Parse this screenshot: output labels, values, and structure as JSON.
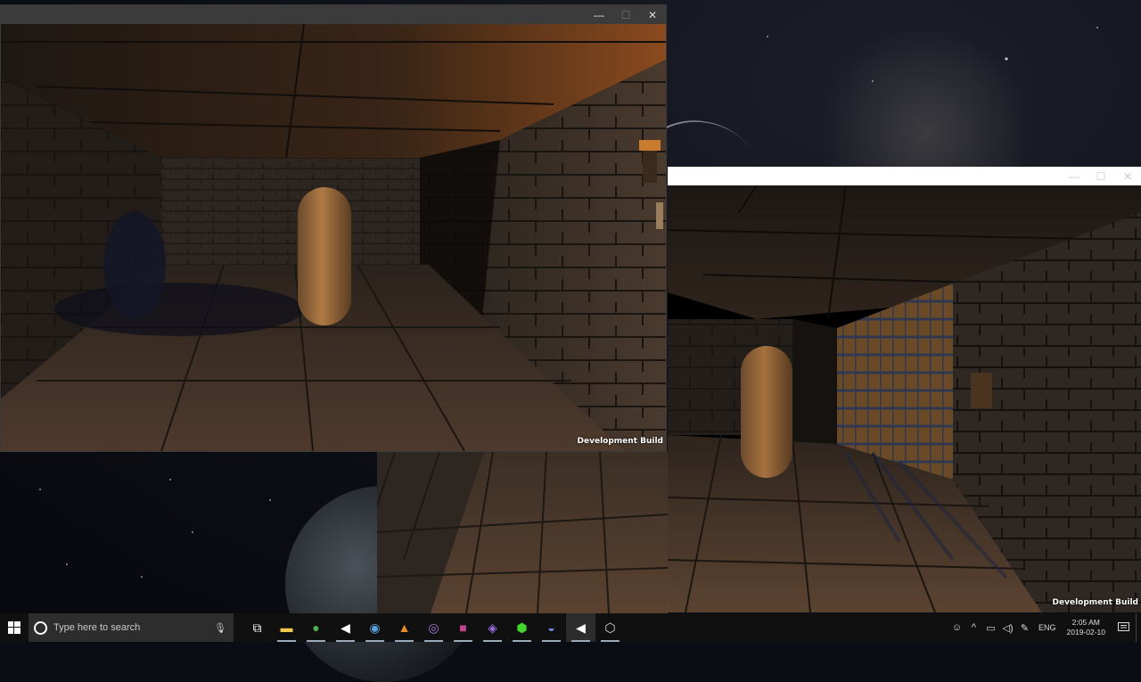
{
  "window1": {
    "close": "✕",
    "minimize": "—",
    "maximize": "☐",
    "dev_label": "Development Build"
  },
  "window2": {
    "close": "✕",
    "minimize": "—",
    "maximize": "☐",
    "dev_label": "Development Build"
  },
  "taskbar": {
    "search_placeholder": "Type here to search",
    "apps": [
      {
        "name": "task-view-icon",
        "glyph": "⧉",
        "color": "#ffffff"
      },
      {
        "name": "file-explorer-icon",
        "glyph": "▬",
        "color": "#f2c94c"
      },
      {
        "name": "chrome-icon",
        "glyph": "●",
        "color": "#4caf50"
      },
      {
        "name": "unity-icon",
        "glyph": "◀",
        "color": "#ffffff"
      },
      {
        "name": "steam-icon",
        "glyph": "◉",
        "color": "#5aa0d8"
      },
      {
        "name": "vlc-icon",
        "glyph": "▲",
        "color": "#f08a24"
      },
      {
        "name": "obs-icon",
        "glyph": "◎",
        "color": "#a07bdc"
      },
      {
        "name": "rider-icon",
        "glyph": "■",
        "color": "#c2478f"
      },
      {
        "name": "visual-studio-icon",
        "glyph": "◈",
        "color": "#9a6ee0"
      },
      {
        "name": "razer-icon",
        "glyph": "⬢",
        "color": "#44d62c"
      },
      {
        "name": "discord-icon",
        "glyph": "◒",
        "color": "#7289da"
      },
      {
        "name": "unity-player-icon",
        "glyph": "◀",
        "color": "#ffffff"
      },
      {
        "name": "unity-hub-icon",
        "glyph": "⬡",
        "color": "#dddddd"
      }
    ],
    "clock_time": "2:05 AM",
    "clock_date": "2019-02-10",
    "language": "ENG"
  }
}
